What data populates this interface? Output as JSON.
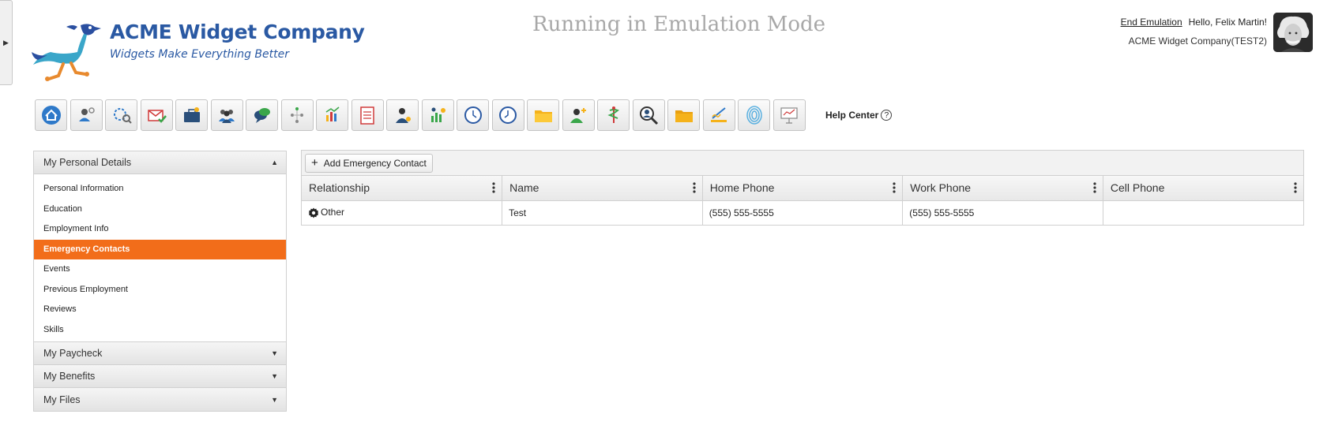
{
  "header": {
    "company_name": "ACME Widget Company",
    "tagline": "Widgets Make Everything Better",
    "mode_banner": "Running in Emulation Mode",
    "end_emulation": "End Emulation",
    "greeting": "Hello, Felix Martin!",
    "company_context": "ACME Widget Company(TEST2)"
  },
  "toolbar": {
    "icons": [
      "home-icon",
      "employee-settings-icon",
      "settings-search-icon",
      "mail-check-icon",
      "briefcase-icon",
      "team-icon",
      "chat-icon",
      "org-chart-icon",
      "report-chart-icon",
      "checklist-icon",
      "employee-badge-icon",
      "analytics-people-icon",
      "clock-icon",
      "clock-alt-icon",
      "folder-icon",
      "user-add-icon",
      "medical-icon",
      "search-person-icon",
      "folder-alt-icon",
      "signature-icon",
      "fingerprint-icon",
      "presentation-icon"
    ],
    "help_label": "Help Center",
    "help_glyph": "?"
  },
  "sidebar": {
    "sections": [
      {
        "label": "My Personal Details",
        "expanded": true,
        "items": [
          "Personal Information",
          "Education",
          "Employment Info",
          "Emergency Contacts",
          "Events",
          "Previous Employment",
          "Reviews",
          "Skills"
        ],
        "active": "Emergency Contacts"
      },
      {
        "label": "My Paycheck",
        "expanded": false
      },
      {
        "label": "My Benefits",
        "expanded": false
      },
      {
        "label": "My Files",
        "expanded": false
      }
    ]
  },
  "grid": {
    "add_button": "Add Emergency Contact",
    "columns": [
      "Relationship",
      "Name",
      "Home Phone",
      "Work Phone",
      "Cell Phone"
    ],
    "rows": [
      {
        "relationship": "Other",
        "name": "Test",
        "home_phone": "(555) 555-5555",
        "work_phone": "(555) 555-5555",
        "cell_phone": ""
      }
    ]
  },
  "colors": {
    "brand_blue": "#2a59a3",
    "active_orange": "#f26d1a",
    "banner_gray": "#a8a8a8"
  }
}
